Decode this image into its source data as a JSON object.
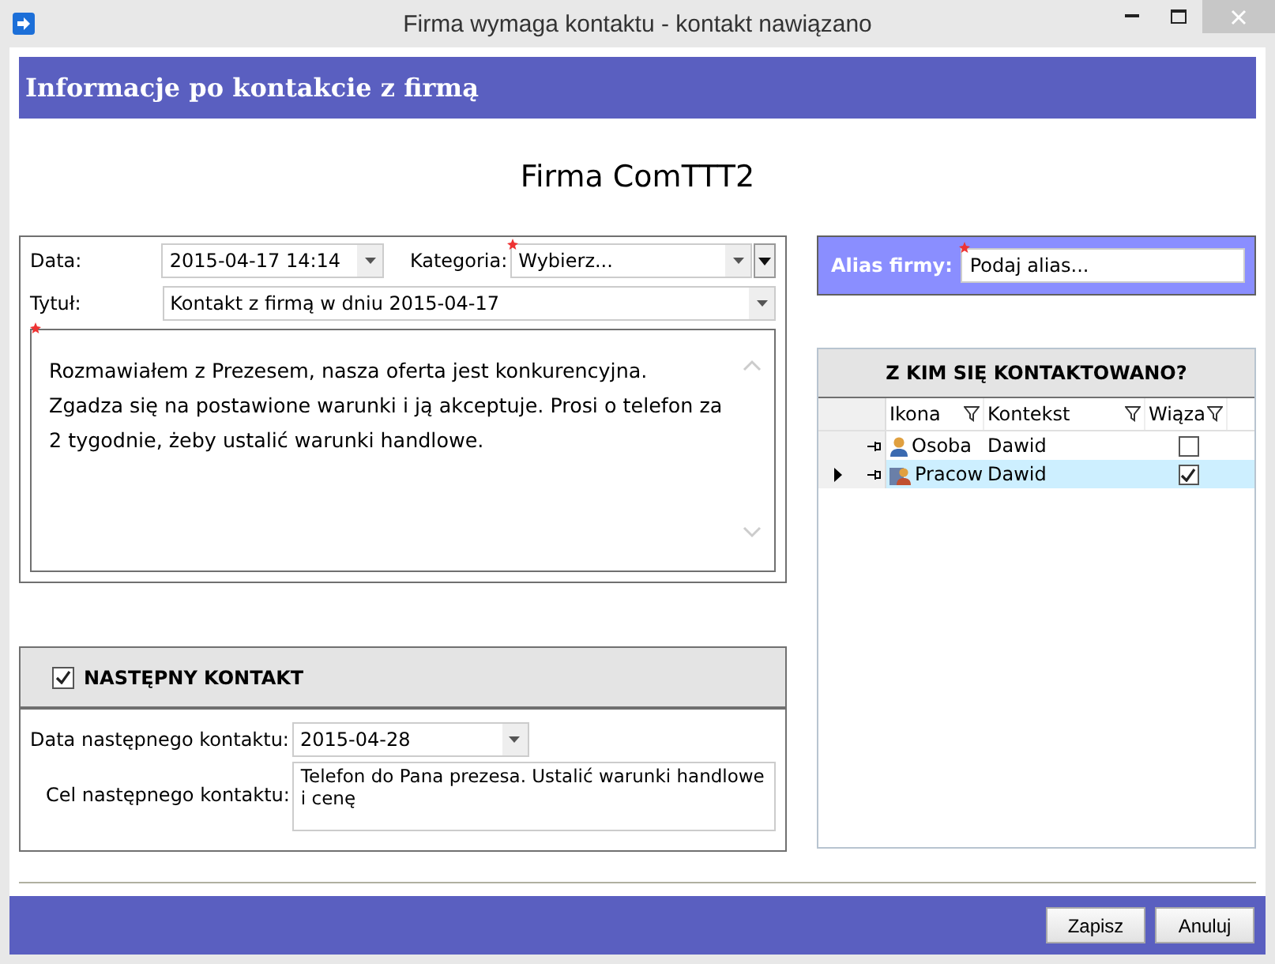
{
  "window": {
    "title": "Firma wymaga kontaktu - kontakt nawiązano"
  },
  "header": "Informacje po kontakcie z firmą",
  "company": "Firma ComTTT2",
  "form": {
    "date_label": "Data:",
    "date": "2015-04-17 14:14",
    "category_label": "Kategoria:",
    "category_placeholder": "Wybierz...",
    "category_required": true,
    "title_label": "Tytuł:",
    "title": "Kontakt z firmą  w dniu 2015-04-17",
    "note_required": true,
    "note": "Rozmawiałem z Prezesem, nasza oferta jest konkurencyjna. Zgadza się na postawione warunki i ją akceptuje.  Prosi o telefon za 2 tygodnie, żeby ustalić warunki handlowe."
  },
  "alias": {
    "label": "Alias firmy:",
    "placeholder": "Podaj alias...",
    "required": true
  },
  "contacts": {
    "title": "Z KIM SIĘ KONTAKTOWANO?",
    "columns": [
      "Ikona",
      "Kontekst",
      "Wiąza"
    ],
    "rows": [
      {
        "kind": "person",
        "type": "Osoba",
        "context": "Dawid",
        "bound": false,
        "selected": false
      },
      {
        "kind": "employee",
        "type": "Pracow",
        "context": "Dawid",
        "bound": true,
        "selected": true
      }
    ]
  },
  "next": {
    "checked": true,
    "label": "NASTĘPNY KONTAKT",
    "date_label": "Data następnego kontaktu:",
    "date": "2015-04-28",
    "goal_label": "Cel następnego kontaktu:",
    "goal": "Telefon do Pana prezesa. Ustalić warunki handlowe i cenę"
  },
  "buttons": [
    "Zapisz",
    "Anuluj"
  ]
}
